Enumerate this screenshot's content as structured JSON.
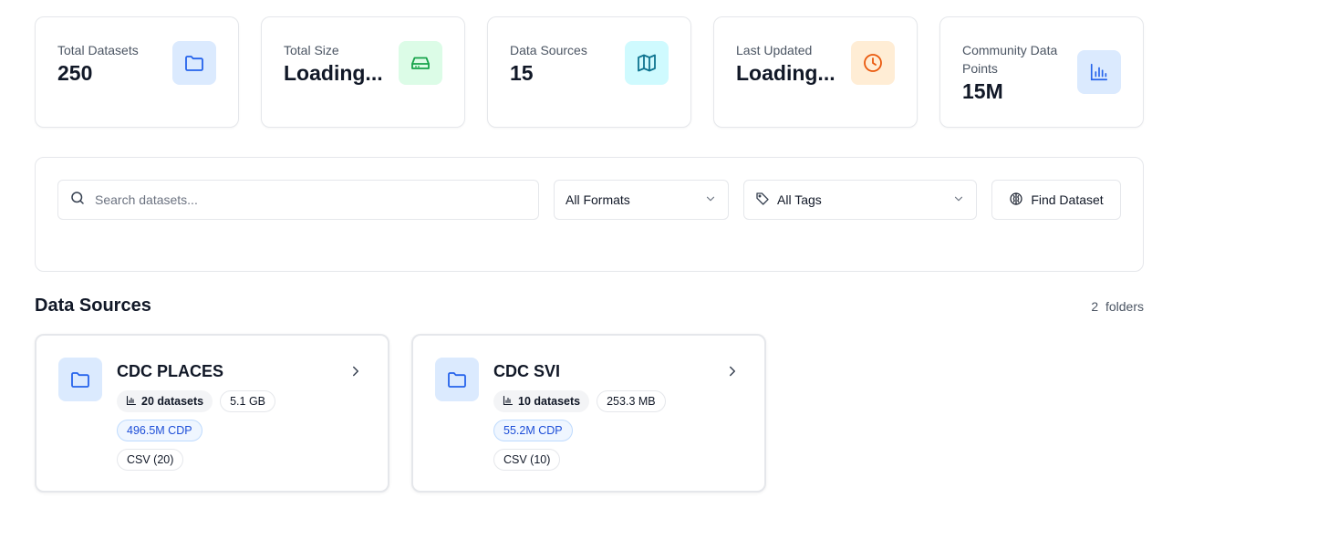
{
  "stats": [
    {
      "label": "Total Datasets",
      "value": "250",
      "icon": "folder-icon"
    },
    {
      "label": "Total Size",
      "value": "Loading...",
      "icon": "hard-drive-icon"
    },
    {
      "label": "Data Sources",
      "value": "15",
      "icon": "map-icon"
    },
    {
      "label": "Last Updated",
      "value": "Loading...",
      "icon": "clock-icon"
    },
    {
      "label": "Community Data Points",
      "value": "15M",
      "icon": "bar-chart-icon"
    }
  ],
  "filters": {
    "search_placeholder": "Search datasets...",
    "format_selected": "All Formats",
    "tags_selected": "All Tags",
    "find_label": "Find Dataset"
  },
  "section": {
    "title": "Data Sources",
    "count": "2",
    "count_unit": "folders"
  },
  "sources": [
    {
      "name": "CDC PLACES",
      "datasets": "20 datasets",
      "size": "5.1 GB",
      "cdp": "496.5M CDP",
      "format": "CSV (20)"
    },
    {
      "name": "CDC SVI",
      "datasets": "10 datasets",
      "size": "253.3 MB",
      "cdp": "55.2M CDP",
      "format": "CSV (10)"
    }
  ],
  "colors": {
    "blue_tile": "#dbeafe",
    "green_tile": "#dcfce7",
    "cyan_tile": "#cffafe",
    "orange_tile": "#ffedd5",
    "blue_icon": "#2563eb",
    "green_icon": "#16a34a",
    "cyan_icon": "#0e7490",
    "orange_icon": "#ea580c"
  }
}
